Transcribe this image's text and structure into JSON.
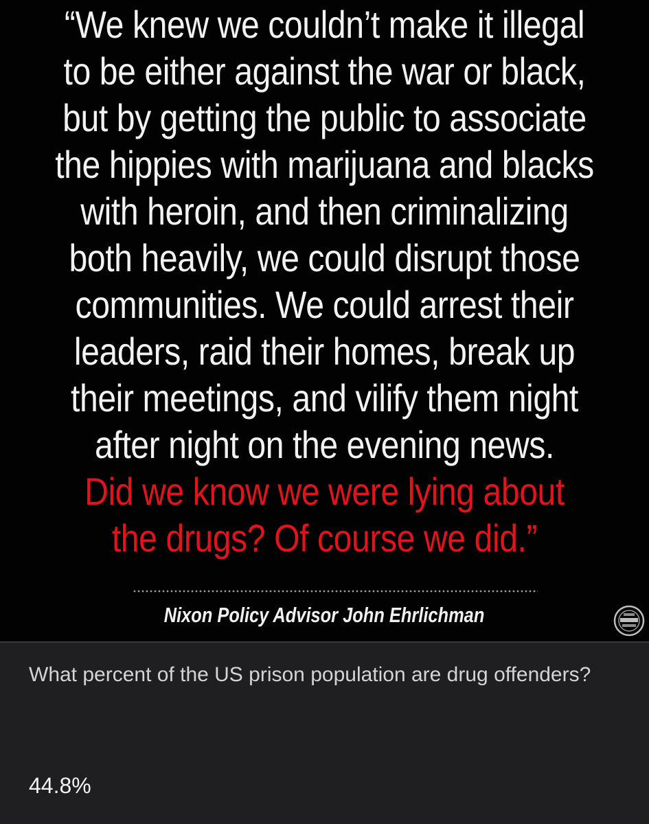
{
  "quote": {
    "lines": [
      "“We knew we couldn’t make it illegal",
      "to be either against the war or black,",
      "but by getting the public to associate",
      "the hippies with marijuana and blacks",
      "with heroin, and then criminalizing",
      "both heavily, we could disrupt those",
      "communities. We could arrest their",
      "leaders, raid their homes, break up",
      "their meetings, and vilify them night",
      "after night on the evening news."
    ],
    "highlight_lines": [
      "Did we know we were lying about",
      "the drugs? Of course we did.”"
    ],
    "attribution": "Nixon Policy Advisor John Ehrlichman",
    "text_color": "#f2f2f2",
    "highlight_color": "#e0141a",
    "seal_icon": "seal-icon"
  },
  "card": {
    "question": "What percent of the US prison population are drug offenders?",
    "answer": "44.8%"
  }
}
